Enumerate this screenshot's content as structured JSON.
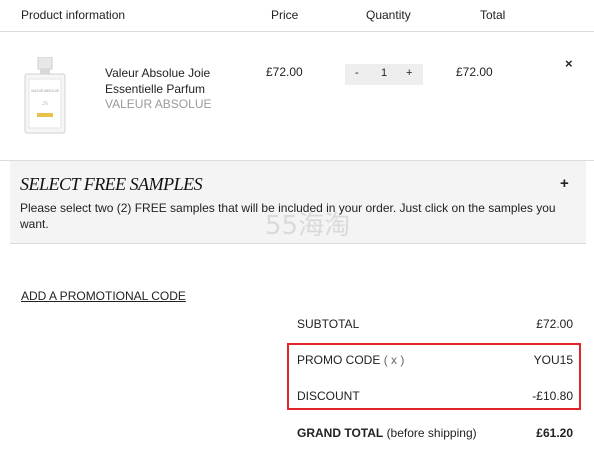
{
  "header": {
    "product": "Product information",
    "price": "Price",
    "quantity": "Quantity",
    "total": "Total"
  },
  "item": {
    "name": "Valeur Absolue Joie Essentielle Parfum",
    "brand": "VALEUR ABSOLUE",
    "price": "£72.00",
    "qty_minus": "-",
    "quantity": "1",
    "qty_plus": "+",
    "total": "£72.00",
    "remove": "×",
    "thumb_text": "VALEUR ABSOLUE"
  },
  "samples": {
    "title": "SELECT FREE SAMPLES",
    "toggle": "+",
    "description": "Please select two (2) FREE samples that will be included in your order. Just click on the samples you want."
  },
  "watermark": "55海淘",
  "promo_link": "ADD A PROMOTIONAL CODE",
  "summary": {
    "subtotal_label": "SUBTOTAL",
    "subtotal_value": "£72.00",
    "promo_label": "PROMO CODE",
    "promo_remove": "( x )",
    "promo_value": "YOU15",
    "discount_label": "DISCOUNT",
    "discount_value": "-£10.80",
    "grand_label": "GRAND TOTAL",
    "grand_note": "(before shipping)",
    "grand_value": "£61.20"
  },
  "colors": {
    "highlight": "#e0262b",
    "samples_bg": "#f4f4f4",
    "brand_gray": "#9a9a9a"
  }
}
